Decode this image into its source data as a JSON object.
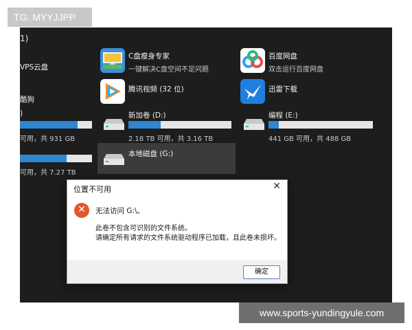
{
  "group_header": "1)",
  "left_partial": {
    "wps_label": "VPS云盘",
    "baidu_dog_label": "酷狗",
    "drive_c_paren": ")",
    "drive_c_sub": "可用，共 931 GB",
    "drive_c_fill": 0.8,
    "drive_f_sub": "可用，共 7.27 TB",
    "drive_f_fill": 0.65
  },
  "apps": [
    {
      "name": "C盘瘦身专家",
      "sub": "一键解决C盘空间不足问题",
      "icon": "c-drive-cleaner-icon"
    },
    {
      "name": "百度网盘",
      "sub": "双击运行百度网盘",
      "icon": "baidu-netdisk-icon"
    },
    {
      "name": "腾讯视频 (32 位)",
      "icon": "tencent-video-icon"
    },
    {
      "name": "迅雷下载",
      "icon": "thunder-download-icon"
    }
  ],
  "drives": [
    {
      "name": "新加卷 (D:)",
      "sub": "2.18 TB 可用，共 3.16 TB",
      "fill": 0.31
    },
    {
      "name": "编程 (E:)",
      "sub": "441 GB 可用，共 488 GB",
      "fill": 0.1
    },
    {
      "name": "本地磁盘 (G:)"
    }
  ],
  "dialog": {
    "title": "位置不可用",
    "close_label": "✕",
    "message": "无法访问 G:\\。",
    "detail_line1": "此卷不包含可识别的文件系统。",
    "detail_line2": "请确定所有请求的文件系统驱动程序已加载，且此卷未损坏。",
    "ok_label": "确定"
  },
  "watermarks": {
    "top": "TG: MYYJJPP",
    "bottom": "www.sports-yundingyule.com"
  },
  "colors": {
    "explorer_bg": "#1d1d1d",
    "progress_fill": "#2f86d1",
    "error_red": "#e0572a"
  }
}
